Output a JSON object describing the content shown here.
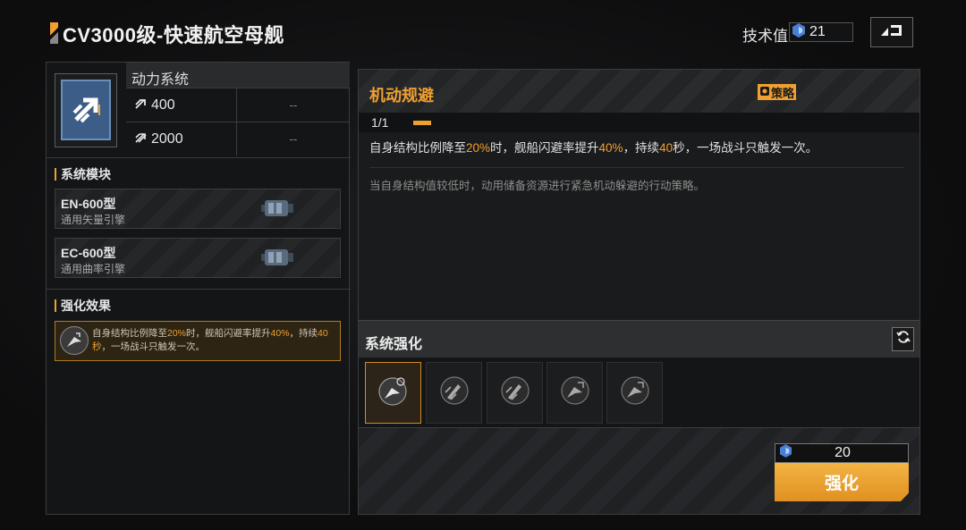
{
  "header": {
    "title": "CV3000级-快速航空母舰",
    "tech_label": "技术值:",
    "tech_value": "21"
  },
  "power_system": {
    "title": "动力系统",
    "rows": [
      {
        "value": "400",
        "extra": "--"
      },
      {
        "value": "2000",
        "extra": "--"
      }
    ]
  },
  "modules": {
    "title": "系统模块",
    "items": [
      {
        "name": "EN-600型",
        "sub": "通用矢量引擎"
      },
      {
        "name": "EC-600型",
        "sub": "通用曲率引擎"
      }
    ]
  },
  "effect": {
    "title": "强化效果",
    "text_a": "自身结构比例降至",
    "pct1": "20%",
    "text_b": "时，舰船闪避率提升",
    "pct2": "40%",
    "text_c": "，持续",
    "dur": "40秒",
    "text_d": "，一场战斗只触发一次。"
  },
  "skill": {
    "title": "机动规避",
    "tag": "策略",
    "level": "1/1",
    "desc_a": "自身结构比例降至",
    "desc_pct1": "20%",
    "desc_b": "时，舰船闪避率提升",
    "desc_pct2": "40%",
    "desc_c": "，持续",
    "desc_dur": "40",
    "desc_d": "秒，一场战斗只触发一次。",
    "flavor": "当自身结构值较低时，动用储备资源进行紧急机动躲避的行动策略。"
  },
  "enhance": {
    "title": "系统强化",
    "cost": "20",
    "button": "强化"
  },
  "colors": {
    "accent": "#f0a030",
    "icon_blue": "#3b5d88"
  }
}
